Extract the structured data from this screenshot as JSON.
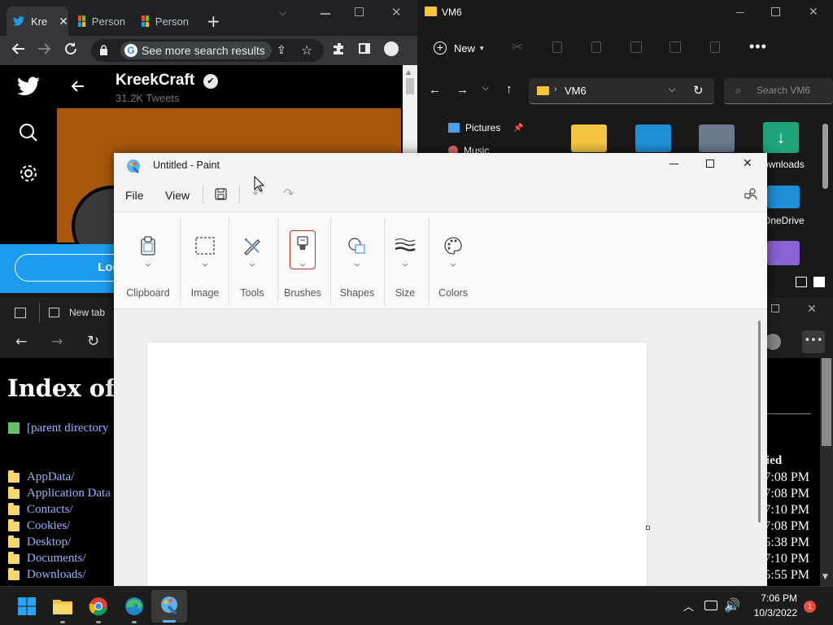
{
  "chrome": {
    "tabs": [
      {
        "label": "Kre"
      },
      {
        "label": "Person"
      },
      {
        "label": "Person"
      }
    ],
    "omnibox_chip": "See more search results",
    "twitter": {
      "profile_name": "KreekCraft",
      "tweet_count": "31.2K Tweets",
      "login_label": "Log i"
    }
  },
  "explorer": {
    "title": "VM6",
    "new_label": "New",
    "breadcrumb": "VM6",
    "search_placeholder": "Search VM6",
    "quick_access": [
      {
        "label": "Pictures"
      },
      {
        "label": "Music"
      }
    ],
    "items": [
      {
        "label": "ownloads"
      },
      {
        "label": "OneDrive"
      }
    ]
  },
  "edge": {
    "tab_label": "New tab",
    "heading": "Index of C",
    "parent": "[parent directory",
    "dirs": [
      "AppData/",
      "Application Data",
      "Contacts/",
      "Cookies/",
      "Desktop/",
      "Documents/",
      "Downloads/"
    ],
    "col_header": "ied",
    "times": [
      "7:08 PM",
      "7:08 PM",
      "7:10 PM",
      "7:08 PM",
      "5:38 PM",
      "7:10 PM",
      "5:55 PM"
    ]
  },
  "paint": {
    "title": "Untitled - Paint",
    "menu": {
      "file": "File",
      "view": "View"
    },
    "groups": {
      "clipboard": "Clipboard",
      "image": "Image",
      "tools": "Tools",
      "brushes": "Brushes",
      "shapes": "Shapes",
      "size": "Size",
      "colors": "Colors"
    }
  },
  "taskbar": {
    "time": "7:06 PM",
    "date": "10/3/2022",
    "notification_count": "1"
  },
  "colors": {
    "twitter_blue": "#1d9bf0",
    "paint_accent": "#c42b1c",
    "banner": "#a8580c"
  }
}
